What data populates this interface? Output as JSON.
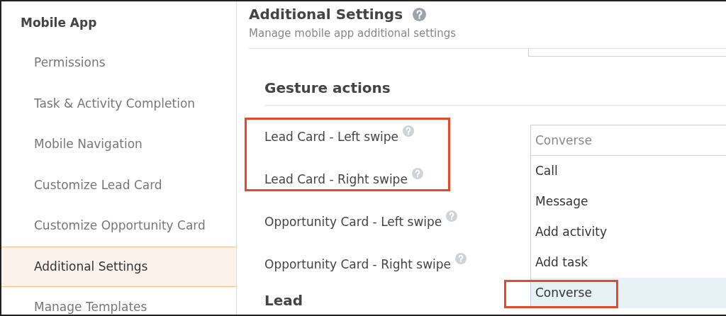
{
  "sidebar": {
    "heading": "Mobile App",
    "items": [
      {
        "label": "Permissions",
        "selected": false
      },
      {
        "label": "Task & Activity Completion",
        "selected": false
      },
      {
        "label": "Mobile Navigation",
        "selected": false
      },
      {
        "label": "Customize Lead Card",
        "selected": false
      },
      {
        "label": "Customize Opportunity Card",
        "selected": false
      },
      {
        "label": "Additional Settings",
        "selected": true
      },
      {
        "label": "Manage Templates",
        "selected": false
      }
    ]
  },
  "page": {
    "title": "Additional Settings",
    "subtitle": "Manage mobile app additional settings"
  },
  "gesture_actions": {
    "heading": "Gesture actions",
    "rows": [
      {
        "label": "Lead Card - Left swipe",
        "highlighted": true
      },
      {
        "label": "Lead Card - Right swipe",
        "highlighted": true
      },
      {
        "label": "Opportunity Card - Left swipe",
        "highlighted": false
      },
      {
        "label": "Opportunity Card - Right swipe",
        "highlighted": false
      }
    ],
    "dropdown": {
      "placeholder": "Converse",
      "expanded": true,
      "options": [
        {
          "label": "Call",
          "selected": false,
          "highlighted": false
        },
        {
          "label": "Message",
          "selected": false,
          "highlighted": false
        },
        {
          "label": "Add activity",
          "selected": false,
          "highlighted": false
        },
        {
          "label": "Add task",
          "selected": false,
          "highlighted": false
        },
        {
          "label": "Converse",
          "selected": true,
          "highlighted": true
        }
      ]
    }
  },
  "next_section": {
    "heading": "Lead"
  }
}
